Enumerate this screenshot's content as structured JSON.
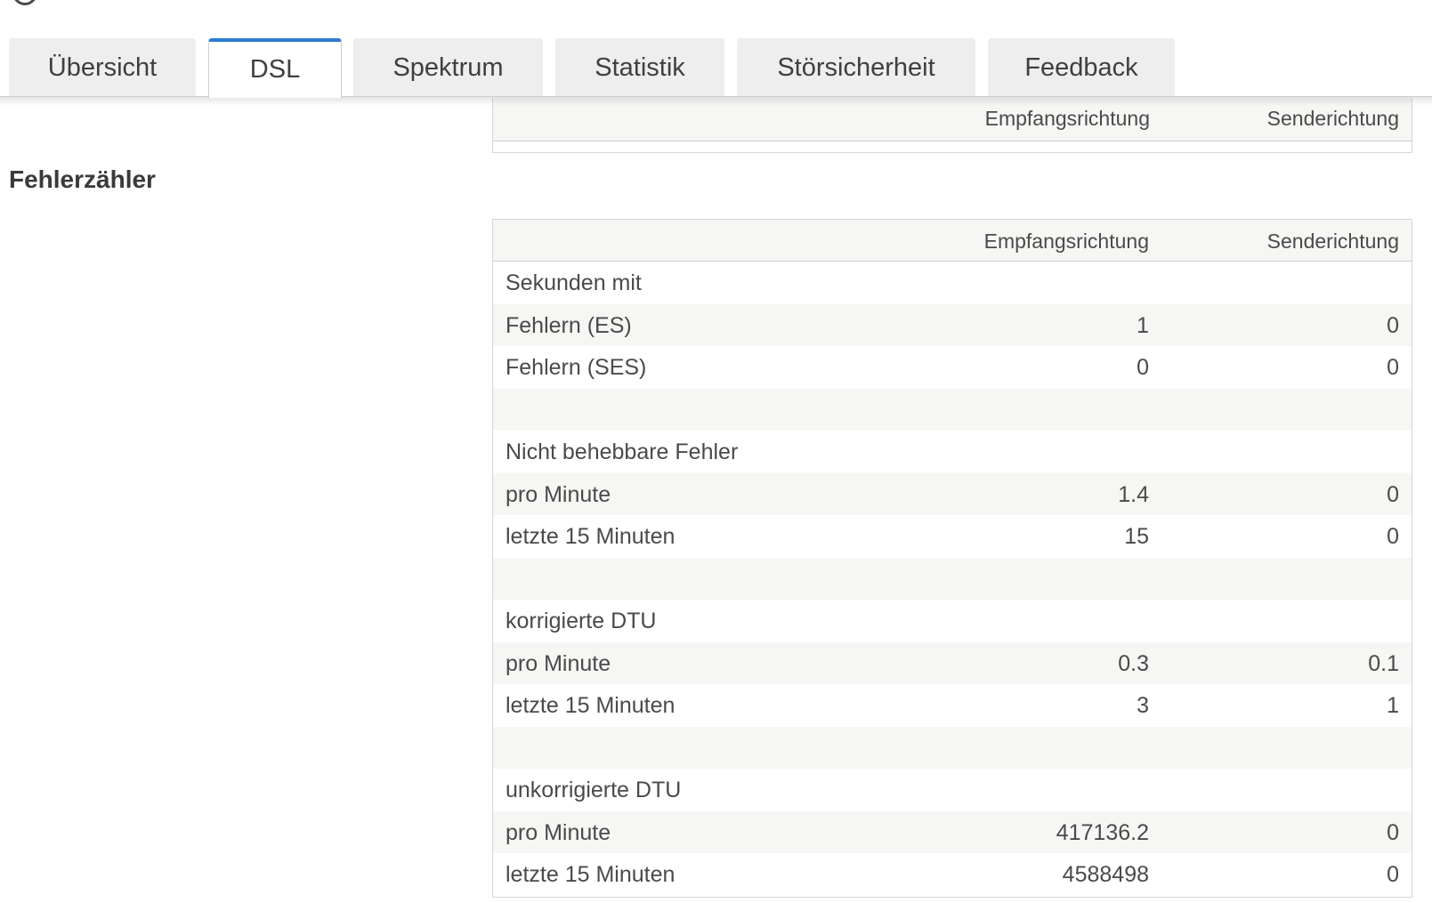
{
  "tabs": [
    {
      "label": "Übersicht"
    },
    {
      "label": "DSL"
    },
    {
      "label": "Spektrum"
    },
    {
      "label": "Statistik"
    },
    {
      "label": "Störsicherheit"
    },
    {
      "label": "Feedback"
    }
  ],
  "active_tab": "DSL",
  "accent_color": "#2a7bd4",
  "top_table": {
    "col_rx": "Empfangsrichtung",
    "col_tx": "Senderichtung"
  },
  "section": {
    "title": "Fehlerzähler"
  },
  "error_table": {
    "col_rx": "Empfangsrichtung",
    "col_tx": "Senderichtung",
    "rows": [
      {
        "label": "Sekunden mit",
        "rx": "",
        "tx": ""
      },
      {
        "label": "Fehlern (ES)",
        "rx": "1",
        "tx": "0"
      },
      {
        "label": "Fehlern (SES)",
        "rx": "0",
        "tx": "0"
      },
      {
        "label": "",
        "rx": "",
        "tx": ""
      },
      {
        "label": "Nicht behebbare Fehler",
        "rx": "",
        "tx": ""
      },
      {
        "label": "pro Minute",
        "rx": "1.4",
        "tx": "0"
      },
      {
        "label": "letzte 15 Minuten",
        "rx": "15",
        "tx": "0"
      },
      {
        "label": "",
        "rx": "",
        "tx": ""
      },
      {
        "label": "korrigierte DTU",
        "rx": "",
        "tx": ""
      },
      {
        "label": "pro Minute",
        "rx": "0.3",
        "tx": "0.1"
      },
      {
        "label": "letzte 15 Minuten",
        "rx": "3",
        "tx": "1"
      },
      {
        "label": "",
        "rx": "",
        "tx": ""
      },
      {
        "label": "unkorrigierte DTU",
        "rx": "",
        "tx": ""
      },
      {
        "label": "pro Minute",
        "rx": "417136.2",
        "tx": "0"
      },
      {
        "label": "letzte 15 Minuten",
        "rx": "4588498",
        "tx": "0"
      }
    ]
  }
}
